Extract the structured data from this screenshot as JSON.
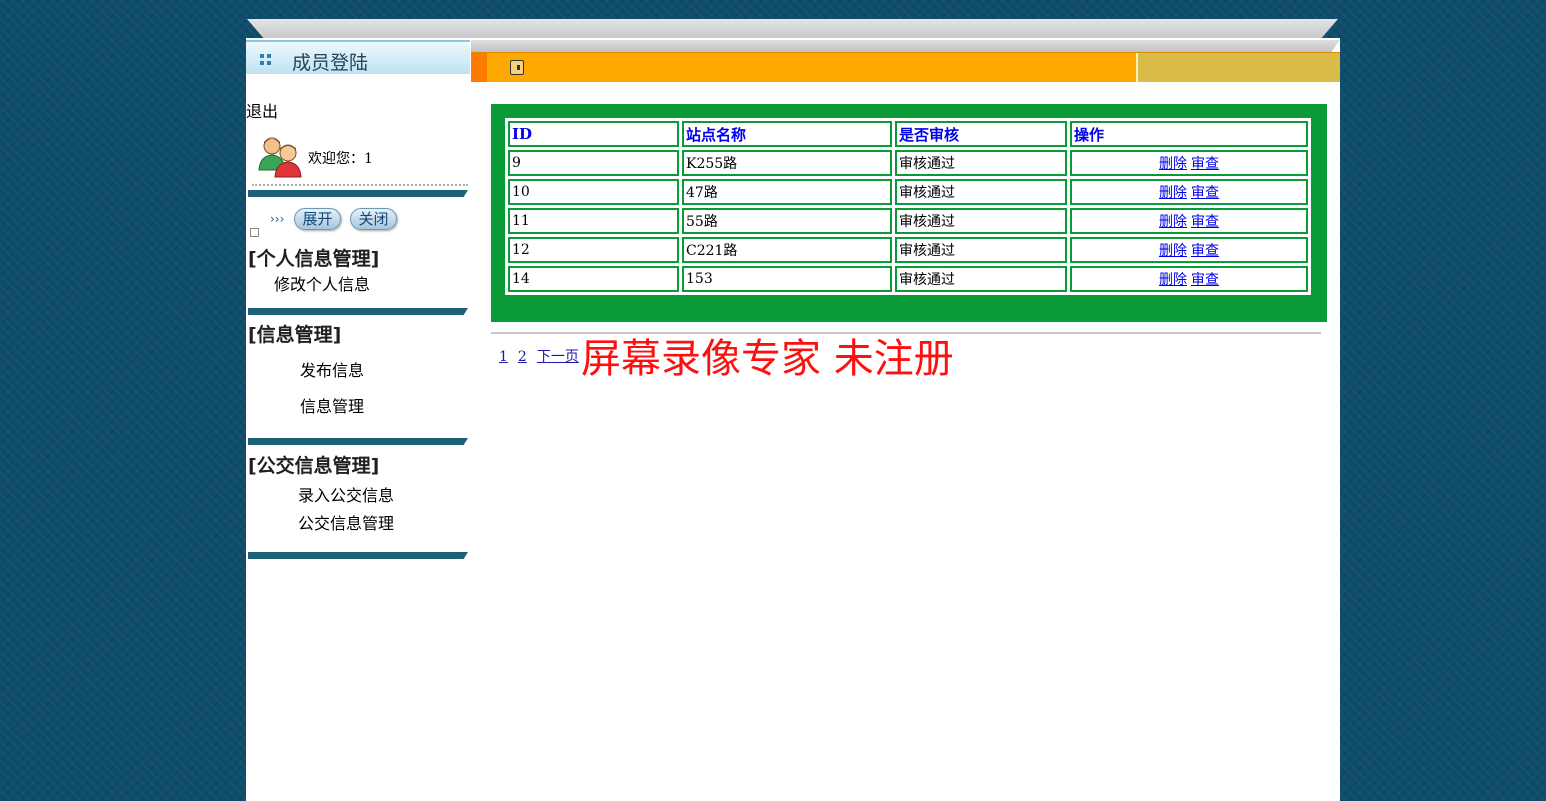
{
  "sidebar": {
    "login_title": "成员登陆",
    "logout": "退出",
    "welcome": "欢迎您：1",
    "expand_button": "展开",
    "collapse_button": "关闭",
    "arrows": "›››",
    "sections": [
      {
        "title": "[个人信息管理]",
        "items": [
          "修改个人信息"
        ]
      },
      {
        "title": "[信息管理]",
        "items": [
          "发布信息",
          "信息管理"
        ]
      },
      {
        "title": "[公交信息管理]",
        "items": [
          "录入公交信息",
          "公交信息管理"
        ]
      }
    ]
  },
  "table": {
    "headers": [
      "ID",
      "站点名称",
      "是否审核",
      "操作"
    ],
    "rows": [
      {
        "id": "9",
        "name": "K255路",
        "status": "审核通过",
        "delete": "删除",
        "view": "审查"
      },
      {
        "id": "10",
        "name": "47路",
        "status": "审核通过",
        "delete": "删除",
        "view": "审查"
      },
      {
        "id": "11",
        "name": "55路",
        "status": "审核通过",
        "delete": "删除",
        "view": "审查"
      },
      {
        "id": "12",
        "name": "C221路",
        "status": "审核通过",
        "delete": "删除",
        "view": "审查"
      },
      {
        "id": "14",
        "name": "153",
        "status": "审核通过",
        "delete": "删除",
        "view": "审查"
      }
    ]
  },
  "pager": {
    "pages": [
      "1",
      "2"
    ],
    "next": "下一页"
  },
  "watermark": "屏幕录像专家 未注册",
  "colors": {
    "background": "#0f4d6c",
    "table_border": "#0a9a38",
    "orange_bar": "#fda900",
    "watermark": "#ff1010"
  }
}
